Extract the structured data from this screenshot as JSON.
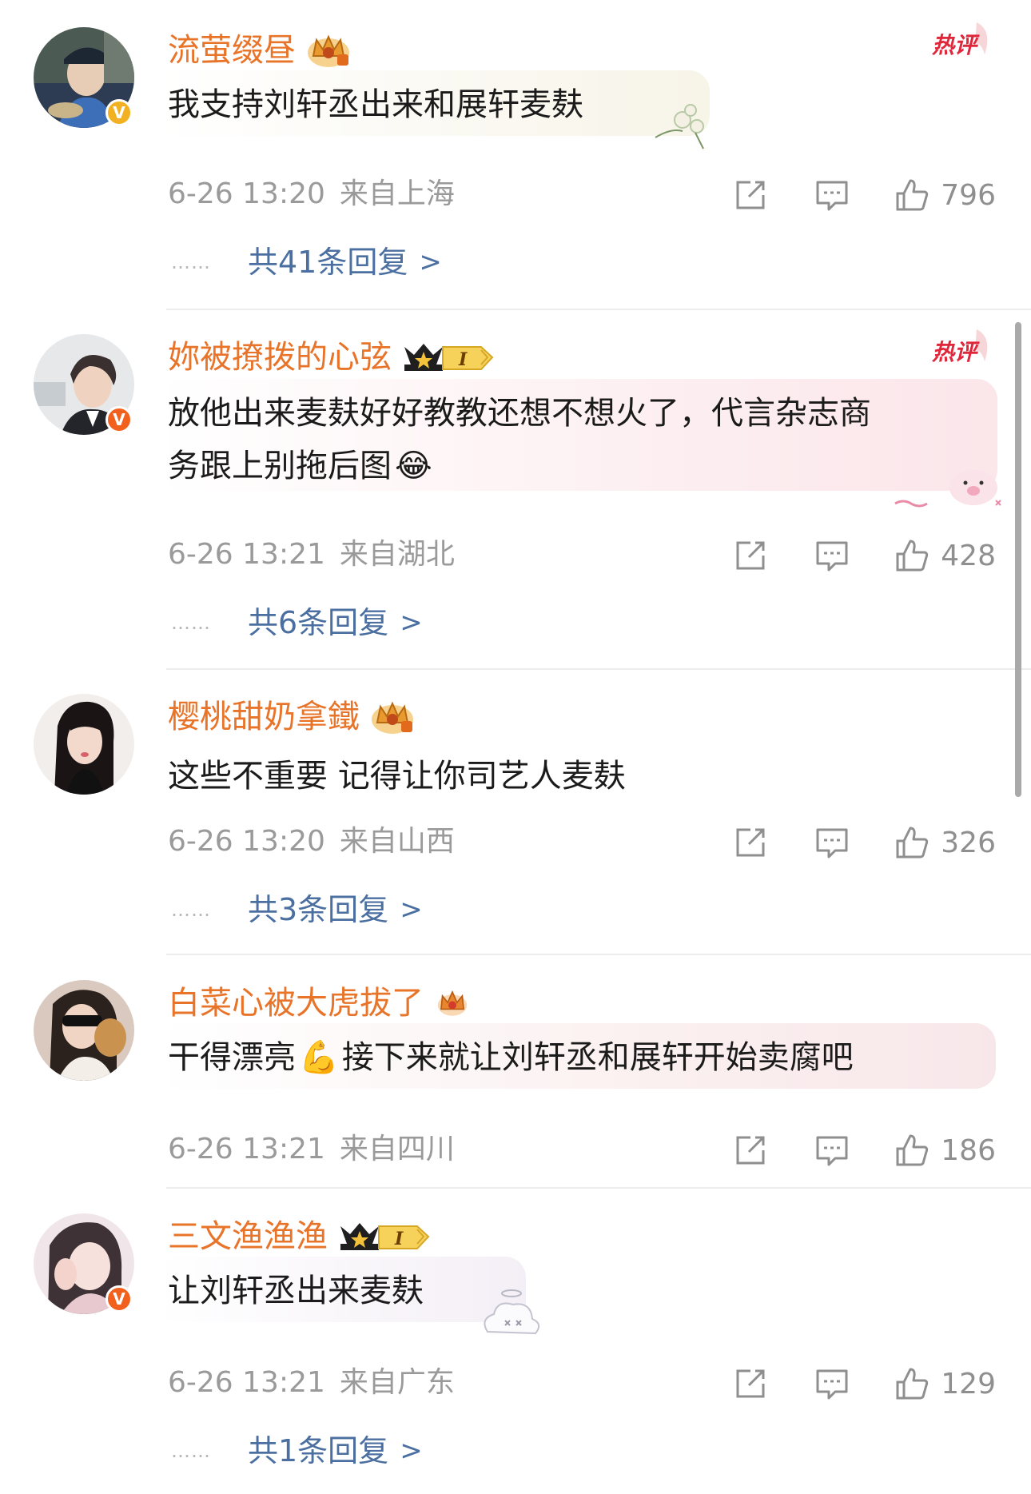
{
  "comments": [
    {
      "username": "流萤缀昼",
      "text_lines": [
        "我支持刘轩丞出来和展轩麦麸"
      ],
      "time": "6-26 13:20",
      "location": "来自上海",
      "likes": "796",
      "hot_label": "热评",
      "replies": "共41条回复",
      "avatar_badge": "V",
      "badge_color": "#f2b122"
    },
    {
      "username": "妳被撩拨的心弦",
      "vip_label": "I",
      "text_lines": [
        "放他出来麦麸好好教教还想不想火了，代言杂志商",
        "务跟上别拖后图"
      ],
      "emoji": "😂",
      "time": "6-26 13:21",
      "location": "来自湖北",
      "likes": "428",
      "hot_label": "热评",
      "replies": "共6条回复",
      "avatar_badge": "V",
      "badge_color": "#f2601d"
    },
    {
      "username": "樱桃甜奶拿鐵",
      "text_lines": [
        "这些不重要 记得让你司艺人麦麸"
      ],
      "time": "6-26 13:20",
      "location": "来自山西",
      "likes": "326",
      "replies": "共3条回复"
    },
    {
      "username": "白菜心被大虎拔了",
      "text_before_emoji": "干得漂亮",
      "emoji": "💪",
      "text_after_emoji": "接下来就让刘轩丞和展轩开始卖腐吧",
      "time": "6-26 13:21",
      "location": "来自四川",
      "likes": "186"
    },
    {
      "username": "三文渔渔渔",
      "vip_label": "I",
      "text_lines": [
        "让刘轩丞出来麦麸"
      ],
      "time": "6-26 13:21",
      "location": "来自广东",
      "likes": "129",
      "replies": "共1条回复",
      "avatar_badge": "V",
      "badge_color": "#f2601d"
    }
  ],
  "reply_dots": "……",
  "reply_chevron": ">",
  "colors": {
    "username": "#e8742a",
    "reply_link": "#4b6fa0",
    "meta": "#9a9a9a",
    "hot": "#e0263b"
  }
}
